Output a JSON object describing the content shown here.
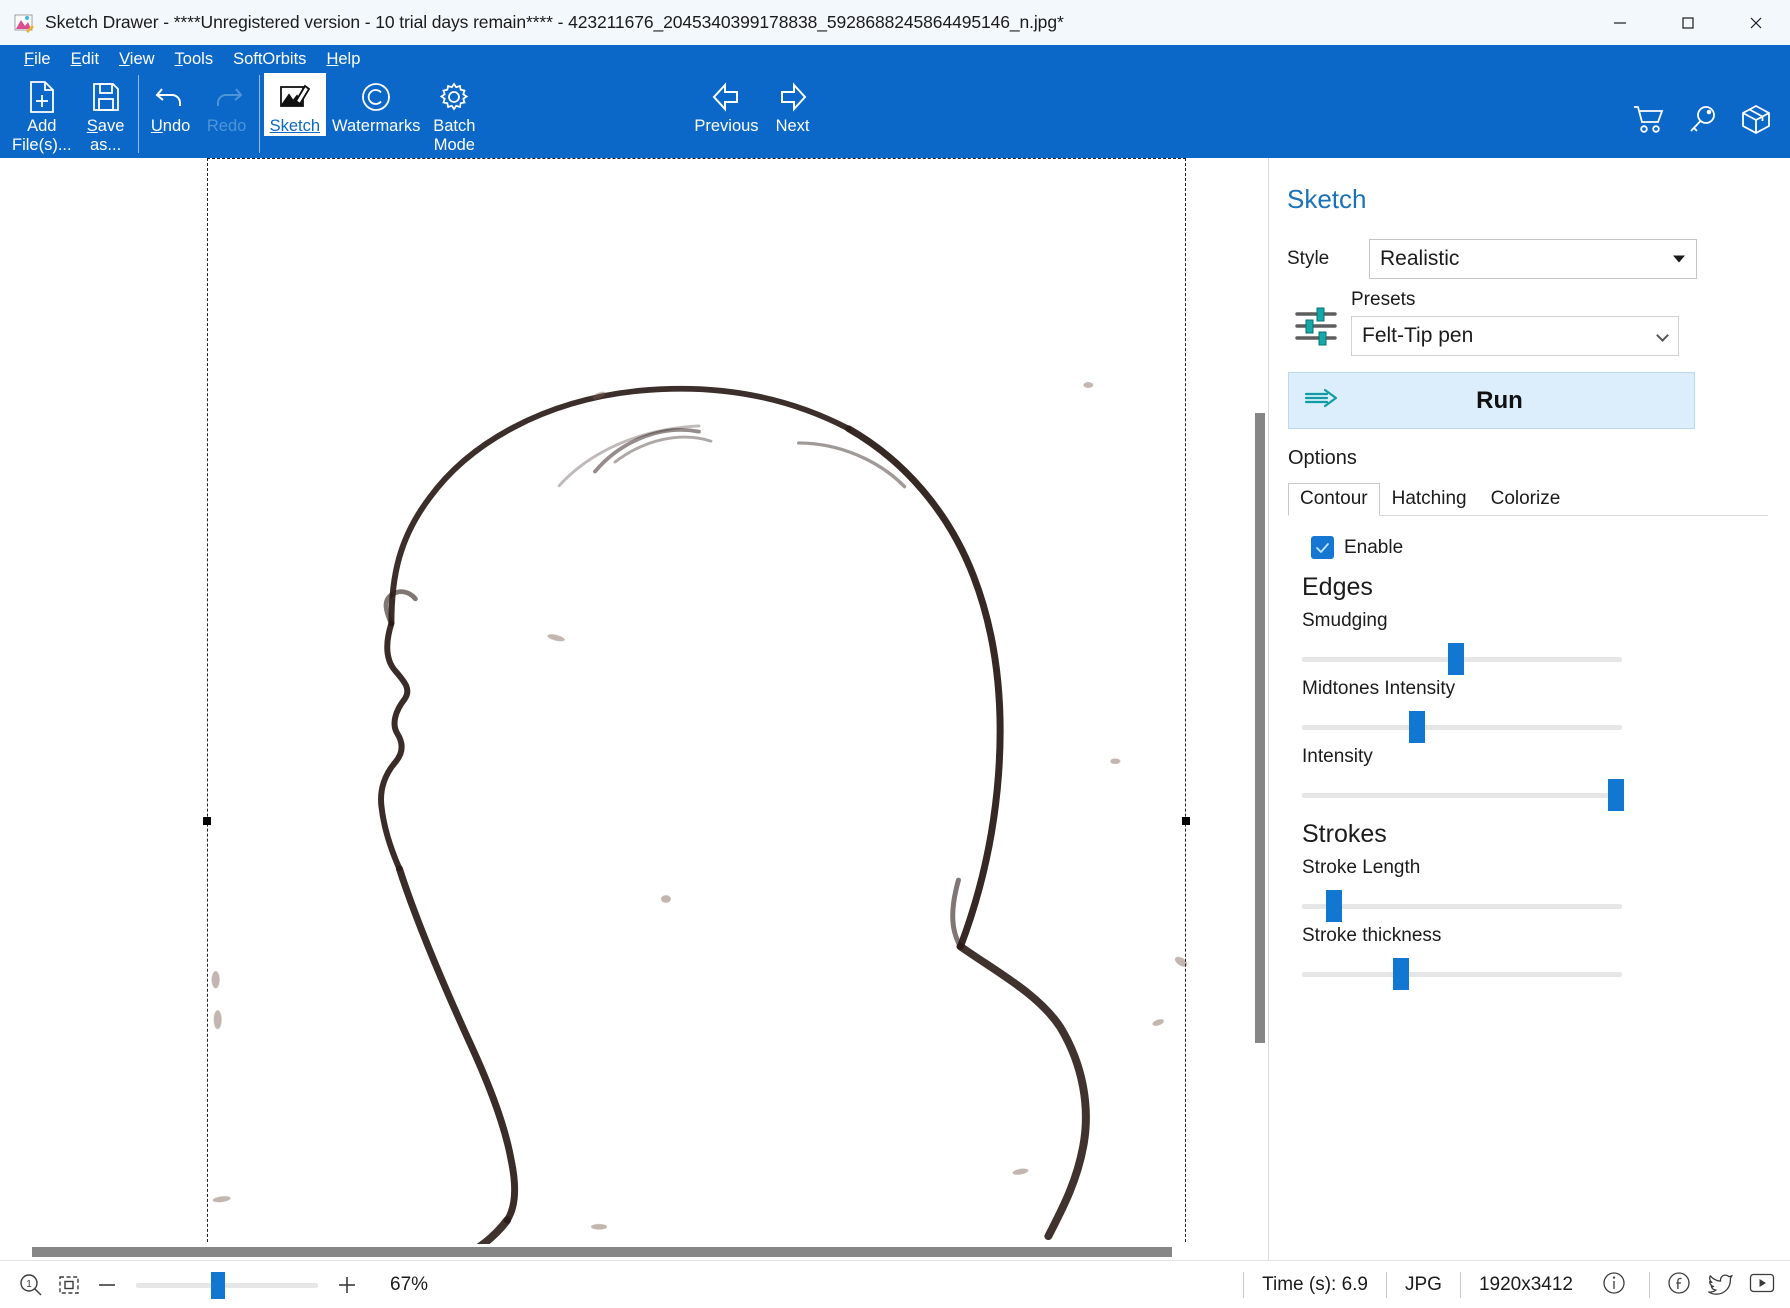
{
  "window": {
    "title": "Sketch Drawer - ****Unregistered version - 10 trial days remain**** - 423211676_2045340399178838_5928688245864495146_n.jpg*",
    "app_icon": "sketch-drawer-app-icon",
    "minimize": "—",
    "maximize": "□",
    "close": "✕"
  },
  "menubar": {
    "items": [
      {
        "label": "File",
        "accel": "F"
      },
      {
        "label": "Edit",
        "accel": "E"
      },
      {
        "label": "View",
        "accel": "V"
      },
      {
        "label": "Tools",
        "accel": "T"
      },
      {
        "label": "SoftOrbits",
        "accel": ""
      },
      {
        "label": "Help",
        "accel": "H"
      }
    ]
  },
  "toolbar": {
    "add_files": "Add\nFile(s)...",
    "save_as": "Save\nas...",
    "undo": "Undo",
    "redo": "Redo",
    "sketch": "Sketch",
    "watermarks": "Watermarks",
    "batch_mode": "Batch\nMode",
    "previous": "Previous",
    "next": "Next",
    "right_icons": [
      "cart-icon",
      "key-icon",
      "box-icon"
    ]
  },
  "panel": {
    "title": "Sketch",
    "style_label": "Style",
    "style_value": "Realistic",
    "presets_label": "Presets",
    "presets_value": "Felt-Tip pen",
    "run_label": "Run",
    "options_label": "Options",
    "tabs": [
      {
        "label": "Contour",
        "active": true
      },
      {
        "label": "Hatching",
        "active": false
      },
      {
        "label": "Colorize",
        "active": false
      }
    ],
    "enable_label": "Enable",
    "enable_checked": true,
    "groups": [
      {
        "heading": "Edges",
        "sliders": [
          {
            "label": "Smudging",
            "value": 48
          },
          {
            "label": "Midtones Intensity",
            "value": 36
          },
          {
            "label": "Intensity",
            "value": 98
          }
        ]
      },
      {
        "heading": "Strokes",
        "sliders": [
          {
            "label": "Stroke Length",
            "value": 10
          },
          {
            "label": "Stroke thickness",
            "value": 34
          }
        ]
      }
    ],
    "accent_color": "#1177d1",
    "title_color": "#1a72b8",
    "run_bg_color": "#dceefb"
  },
  "statusbar": {
    "zoom_reset_icon": "zoom-100-icon",
    "fit_icon": "fit-to-screen-icon",
    "zoom_out": "−",
    "zoom_in": "+",
    "zoom_value": "67%",
    "zoom_percent": 67,
    "time_label": "Time (s): 6.9",
    "format_label": "JPG",
    "dimensions_label": "1920x3412",
    "info_icon": "info-icon",
    "facebook_icon": "facebook-icon",
    "twitter_icon": "twitter-icon",
    "youtube_icon": "youtube-icon"
  },
  "canvas": {
    "description": "pencil sketch outline of a head profile on white paper",
    "zoom": "67%"
  }
}
